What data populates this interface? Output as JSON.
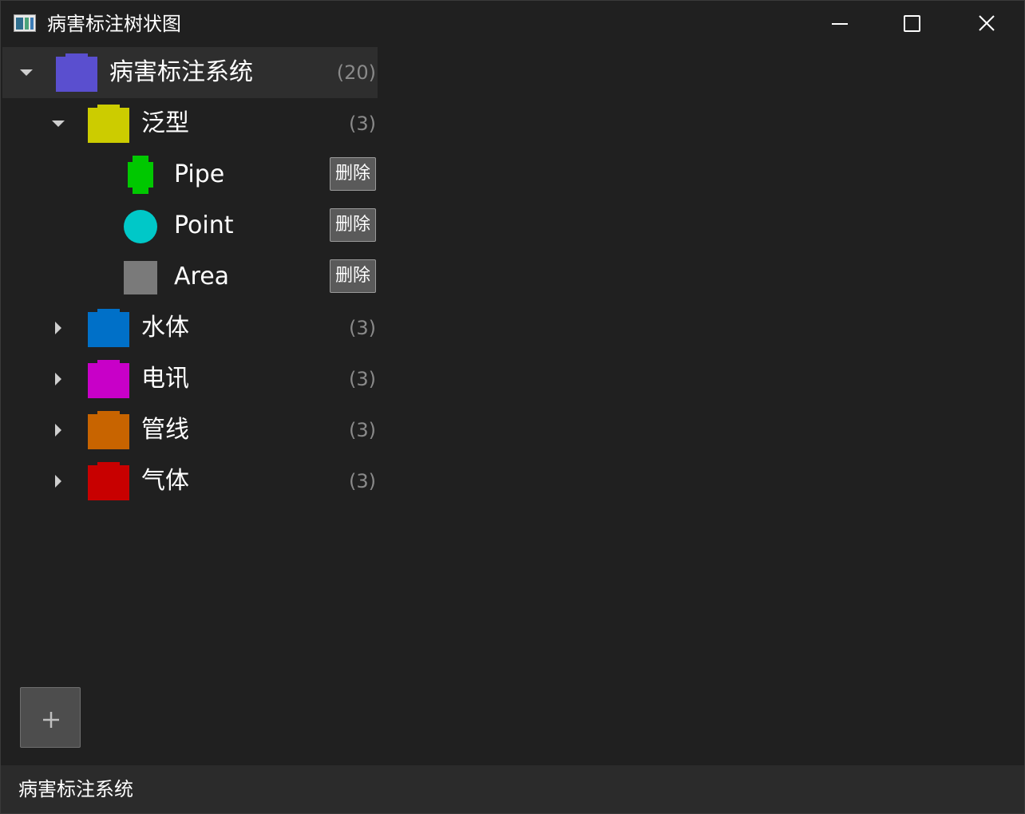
{
  "window": {
    "title": "病害标注树状图",
    "icon": "app-icon",
    "controls": [
      "minimize-icon",
      "maximize-icon",
      "close-icon"
    ]
  },
  "tree": {
    "root": {
      "label": "病害标注系统",
      "count": "(20)",
      "color": "#5a4fcf",
      "expanded": true,
      "selected": true
    },
    "categories": [
      {
        "label": "泛型",
        "count": "(3)",
        "color": "#cccc00",
        "expanded": true,
        "children": [
          {
            "label": "Pipe",
            "color": "#00c800",
            "shape": "octagon",
            "action": "删除"
          },
          {
            "label": "Point",
            "color": "#00c8c8",
            "shape": "circle",
            "action": "删除"
          },
          {
            "label": "Area",
            "color": "#7a7a7a",
            "shape": "square",
            "action": "删除"
          }
        ]
      },
      {
        "label": "水体",
        "count": "(3)",
        "color": "#0070c8",
        "expanded": false
      },
      {
        "label": "电讯",
        "count": "(3)",
        "color": "#c800c8",
        "expanded": false
      },
      {
        "label": "管线",
        "count": "(3)",
        "color": "#c86400",
        "expanded": false
      },
      {
        "label": "气体",
        "count": "(3)",
        "color": "#c80000",
        "expanded": false
      }
    ]
  },
  "add_button": {
    "icon": "plus-icon"
  },
  "statusbar": {
    "text": "病害标注系统"
  }
}
